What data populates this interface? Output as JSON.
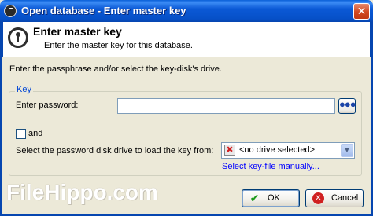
{
  "window": {
    "title": "Open database - Enter master key",
    "close_glyph": "✕"
  },
  "banner": {
    "title": "Enter master key",
    "subtitle": "Enter the master key for this database."
  },
  "intro_text": "Enter the passphrase and/or select the key-disk's drive.",
  "key_group": {
    "legend": "Key",
    "password_label": "Enter password:",
    "password_value": "",
    "toggle_dots": "●●●",
    "and_label": "and",
    "disk_label": "Select the password disk drive to load the key from:",
    "drive_selected": "<no drive selected>",
    "drive_icon_glyph": "✖",
    "combo_arrow_glyph": "▼",
    "keyfile_link": "Select key-file manually..."
  },
  "watermark": "FileHippo.com",
  "buttons": {
    "ok_glyph": "✔",
    "ok_label": "OK",
    "cancel_glyph": "✕",
    "cancel_label": "Cancel"
  },
  "colors": {
    "titlebar": "#0A5FD8",
    "dialog_bg": "#ECE9D8",
    "legend_text": "#0046D5",
    "link": "#0000FF",
    "ok_icon": "#1C9A1C",
    "cancel_icon": "#D02020"
  },
  "icons": {
    "window": "keyhole-icon",
    "banner": "keyhole-icon",
    "drive": "no-drive-icon",
    "ok": "check-icon",
    "cancel": "cancel-icon"
  }
}
